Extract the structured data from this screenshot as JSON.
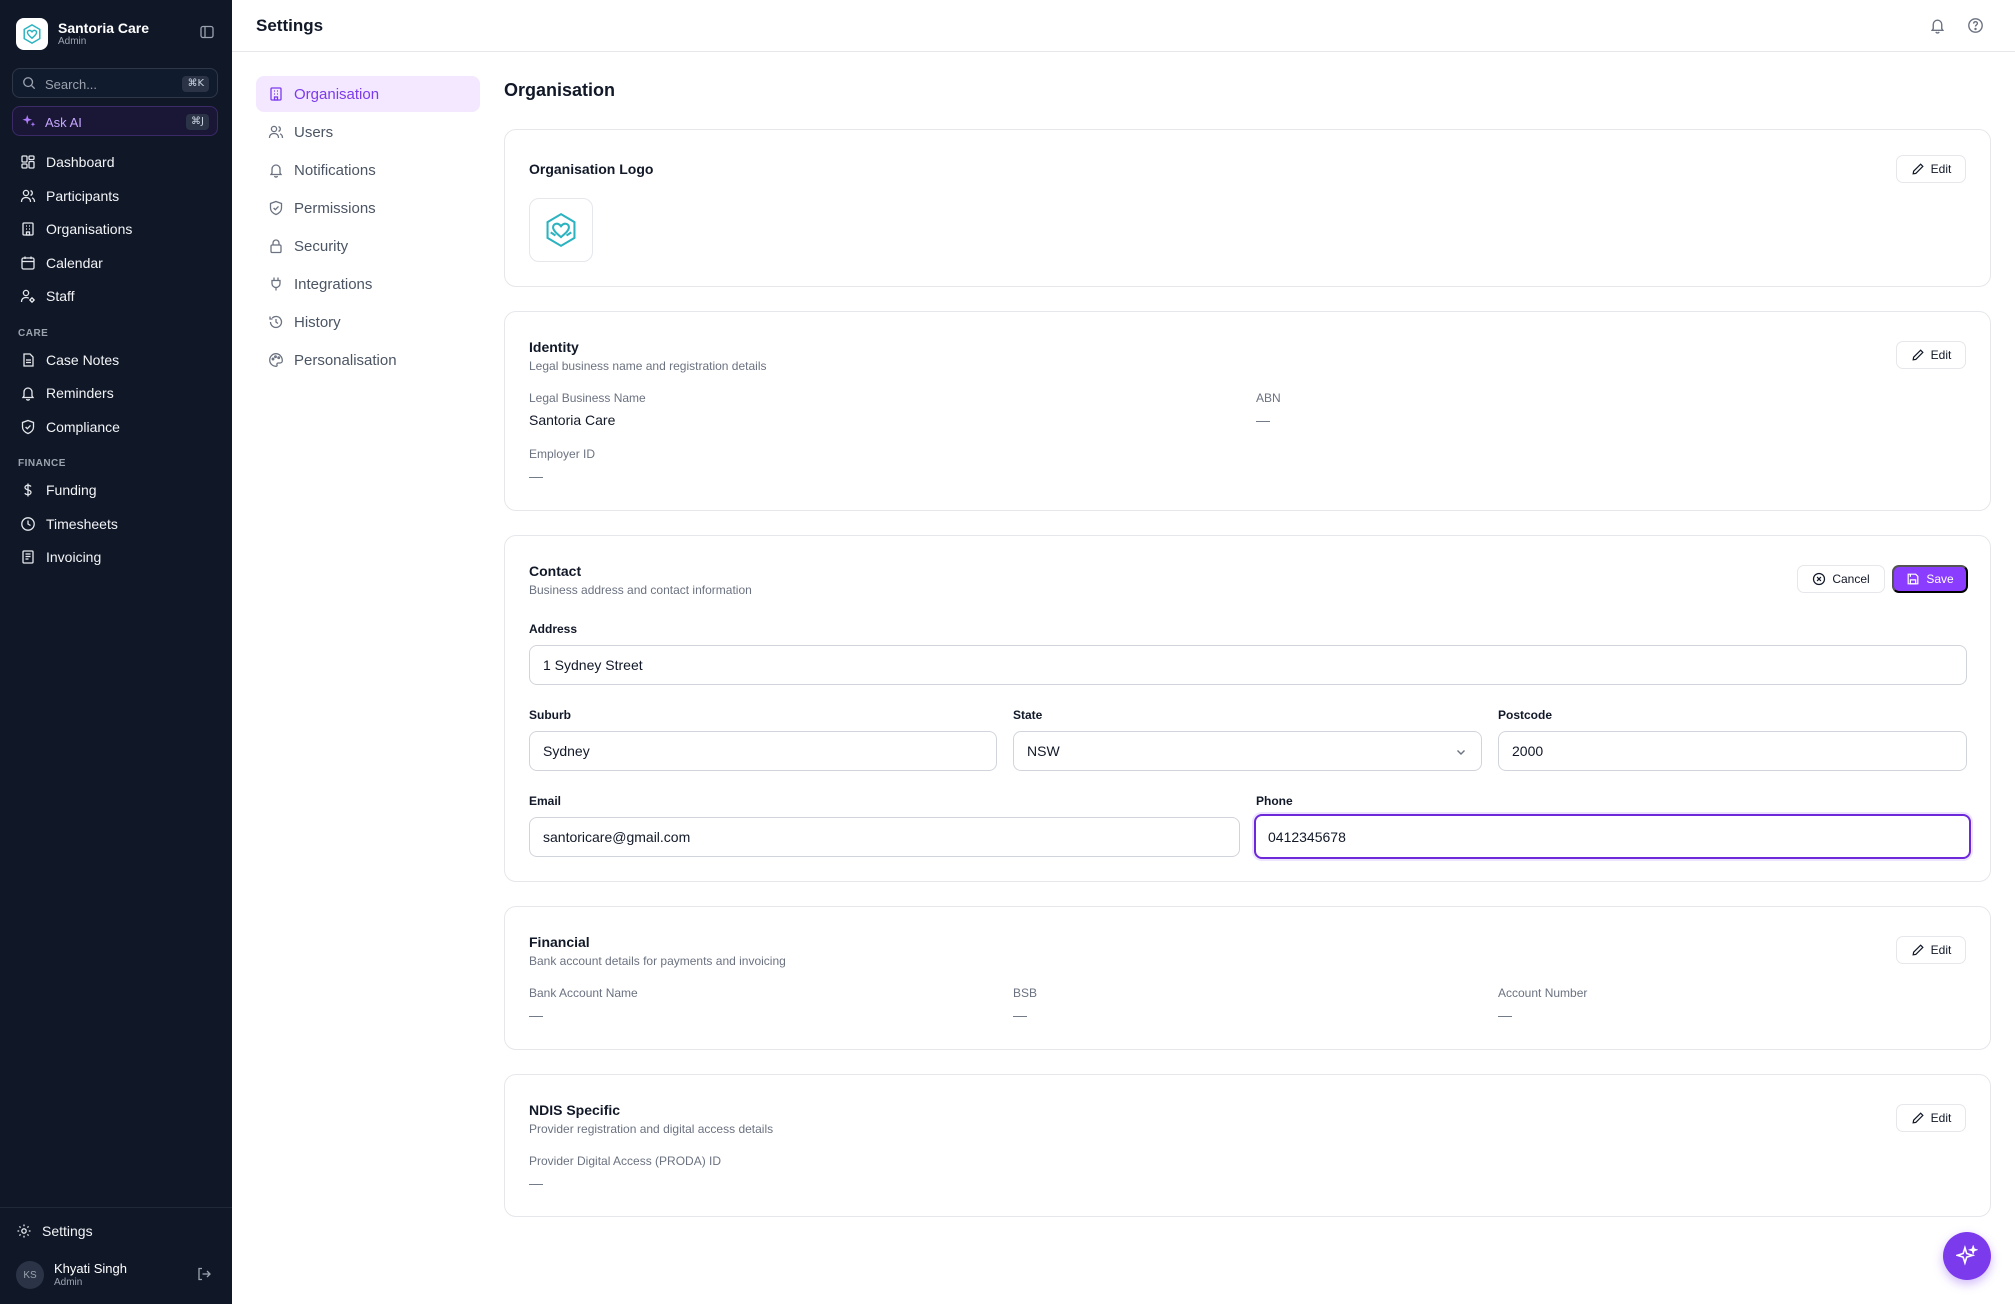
{
  "app": {
    "name": "Santoria Care",
    "role": "Admin"
  },
  "sidebar": {
    "search_placeholder": "Search...",
    "search_shortcut": "⌘K",
    "ask_ai_label": "Ask AI",
    "ask_ai_shortcut": "⌘J",
    "main_items": [
      {
        "label": "Dashboard",
        "icon": "dashboard-icon"
      },
      {
        "label": "Participants",
        "icon": "users-icon"
      },
      {
        "label": "Organisations",
        "icon": "building-icon"
      },
      {
        "label": "Calendar",
        "icon": "calendar-icon"
      },
      {
        "label": "Staff",
        "icon": "user-cog-icon"
      }
    ],
    "care_section": "CARE",
    "care_items": [
      {
        "label": "Case Notes",
        "icon": "notes-icon"
      },
      {
        "label": "Reminders",
        "icon": "bell-icon"
      },
      {
        "label": "Compliance",
        "icon": "shield-check-icon"
      }
    ],
    "finance_section": "FINANCE",
    "finance_items": [
      {
        "label": "Funding",
        "icon": "dollar-icon"
      },
      {
        "label": "Timesheets",
        "icon": "clock-icon"
      },
      {
        "label": "Invoicing",
        "icon": "receipt-icon"
      }
    ],
    "settings_label": "Settings",
    "user": {
      "initials": "KS",
      "name": "Khyati Singh",
      "role": "Admin"
    }
  },
  "header": {
    "title": "Settings"
  },
  "settings_nav": [
    {
      "label": "Organisation",
      "icon": "building-icon",
      "active": true
    },
    {
      "label": "Users",
      "icon": "users-icon",
      "active": false
    },
    {
      "label": "Notifications",
      "icon": "bell-icon",
      "active": false
    },
    {
      "label": "Permissions",
      "icon": "shield-check-icon",
      "active": false
    },
    {
      "label": "Security",
      "icon": "lock-icon",
      "active": false
    },
    {
      "label": "Integrations",
      "icon": "plug-icon",
      "active": false
    },
    {
      "label": "History",
      "icon": "history-icon",
      "active": false
    },
    {
      "label": "Personalisation",
      "icon": "palette-icon",
      "active": false
    }
  ],
  "main": {
    "heading": "Organisation",
    "edit_label": "Edit",
    "logo_card": {
      "title": "Organisation Logo"
    },
    "identity": {
      "title": "Identity",
      "subtitle": "Legal business name and registration details",
      "legal_name_label": "Legal Business Name",
      "legal_name_value": "Santoria Care",
      "abn_label": "ABN",
      "abn_value": "—",
      "employer_id_label": "Employer ID",
      "employer_id_value": "—"
    },
    "contact": {
      "title": "Contact",
      "subtitle": "Business address and contact information",
      "cancel_label": "Cancel",
      "save_label": "Save",
      "address_label": "Address",
      "address_value": "1 Sydney Street",
      "suburb_label": "Suburb",
      "suburb_value": "Sydney",
      "state_label": "State",
      "state_value": "NSW",
      "postcode_label": "Postcode",
      "postcode_value": "2000",
      "email_label": "Email",
      "email_value": "santoricare@gmail.com",
      "phone_label": "Phone",
      "phone_value": "0412345678"
    },
    "financial": {
      "title": "Financial",
      "subtitle": "Bank account details for payments and invoicing",
      "bank_name_label": "Bank Account Name",
      "bank_name_value": "—",
      "bsb_label": "BSB",
      "bsb_value": "—",
      "account_number_label": "Account Number",
      "account_number_value": "—"
    },
    "ndis": {
      "title": "NDIS Specific",
      "subtitle": "Provider registration and digital access details",
      "proda_label": "Provider Digital Access (PRODA) ID",
      "proda_value": "—"
    }
  },
  "colors": {
    "sidebar_bg": "#101828",
    "accent": "#8b3dff",
    "active_nav_bg": "#f3e8ff",
    "logo_teal": "#2bb3c0"
  }
}
